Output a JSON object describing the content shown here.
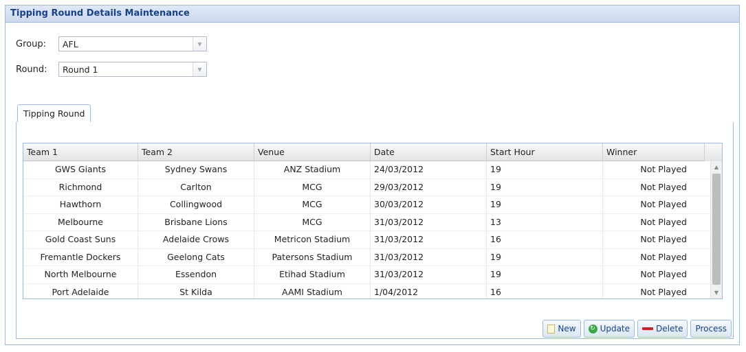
{
  "panel": {
    "title": "Tipping Round Details Maintenance"
  },
  "form": {
    "group": {
      "label": "Group:",
      "value": "AFL"
    },
    "round": {
      "label": "Round:",
      "value": "Round 1"
    }
  },
  "tabs": [
    {
      "label": "Tipping Round"
    }
  ],
  "grid": {
    "columns": [
      "Team 1",
      "Team 2",
      "Venue",
      "Date",
      "Start Hour",
      "Winner"
    ],
    "rows": [
      [
        "GWS Giants",
        "Sydney Swans",
        "ANZ Stadium",
        "24/03/2012",
        "19",
        "Not Played"
      ],
      [
        "Richmond",
        "Carlton",
        "MCG",
        "29/03/2012",
        "19",
        "Not Played"
      ],
      [
        "Hawthorn",
        "Collingwood",
        "MCG",
        "30/03/2012",
        "19",
        "Not Played"
      ],
      [
        "Melbourne",
        "Brisbane Lions",
        "MCG",
        "31/03/2012",
        "13",
        "Not Played"
      ],
      [
        "Gold Coast Suns",
        "Adelaide Crows",
        "Metricon Stadium",
        "31/03/2012",
        "16",
        "Not Played"
      ],
      [
        "Fremantle Dockers",
        "Geelong Cats",
        "Patersons Stadium",
        "31/03/2012",
        "19",
        "Not Played"
      ],
      [
        "North Melbourne",
        "Essendon",
        "Etihad Stadium",
        "31/03/2012",
        "19",
        "Not Played"
      ],
      [
        "Port Adelaide",
        "St Kilda",
        "AAMI Stadium",
        "1/04/2012",
        "16",
        "Not Played"
      ]
    ]
  },
  "buttons": {
    "new": "New",
    "update": "Update",
    "delete": "Delete",
    "process": "Process"
  },
  "icons": {
    "new": "new-document-icon",
    "update": "refresh-icon",
    "delete": "delete-minus-icon",
    "combo_trigger": "chevron-down-icon"
  },
  "colors": {
    "header_text": "#15428b",
    "border": "#99bbe8",
    "delete": "#d21f1f",
    "update": "#3aa648"
  }
}
